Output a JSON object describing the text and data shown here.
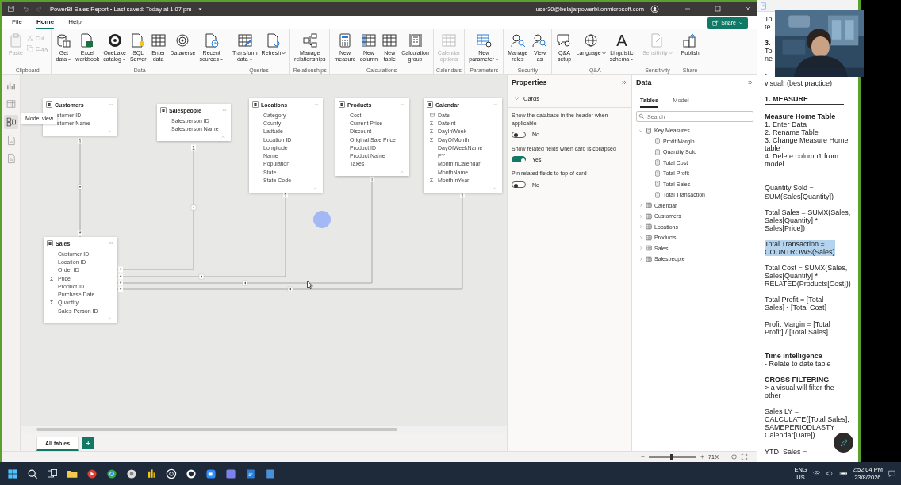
{
  "title_bar": {
    "title": "PowerBI Sales Report • Last saved: Today at 1:07 pm",
    "user": "user30@belajarpowerbi.onmicrosoft.com"
  },
  "menu_tabs": [
    {
      "label": "File",
      "selected": false
    },
    {
      "label": "Home",
      "selected": true
    },
    {
      "label": "Help",
      "selected": false
    }
  ],
  "share_button": {
    "label": "Share"
  },
  "ribbon": {
    "groups": [
      {
        "name": "Clipboard",
        "buttons": [
          {
            "label": "Paste",
            "kind": "large",
            "disabled": true,
            "dropdown": false
          },
          {
            "label": "Cut",
            "kind": "small",
            "disabled": true,
            "dropdown": false
          },
          {
            "label": "Copy",
            "kind": "small",
            "disabled": true,
            "dropdown": false
          }
        ]
      },
      {
        "name": "Data",
        "buttons": [
          {
            "label": "Get\ndata",
            "kind": "large",
            "disabled": false,
            "dropdown": true
          },
          {
            "label": "Excel\nworkbook",
            "kind": "large",
            "disabled": false,
            "dropdown": false
          },
          {
            "label": "OneLake\ncatalog",
            "kind": "large",
            "disabled": false,
            "dropdown": true
          },
          {
            "label": "SQL\nServer",
            "kind": "large",
            "disabled": false,
            "dropdown": false
          },
          {
            "label": "Enter\ndata",
            "kind": "large",
            "disabled": false,
            "dropdown": false
          },
          {
            "label": "Dataverse",
            "kind": "large",
            "disabled": false,
            "dropdown": false
          },
          {
            "label": "Recent\nsources",
            "kind": "large",
            "disabled": false,
            "dropdown": true
          }
        ]
      },
      {
        "name": "Queries",
        "buttons": [
          {
            "label": "Transform\ndata",
            "kind": "large",
            "disabled": false,
            "dropdown": true
          },
          {
            "label": "Refresh",
            "kind": "large",
            "disabled": false,
            "dropdown": true
          }
        ]
      },
      {
        "name": "Relationships",
        "buttons": [
          {
            "label": "Manage\nrelationships",
            "kind": "large",
            "disabled": false,
            "dropdown": false
          }
        ]
      },
      {
        "name": "Calculations",
        "buttons": [
          {
            "label": "New\nmeasure",
            "kind": "large",
            "disabled": false,
            "dropdown": false
          },
          {
            "label": "New\ncolumn",
            "kind": "large",
            "disabled": false,
            "dropdown": false
          },
          {
            "label": "New\ntable",
            "kind": "large",
            "disabled": false,
            "dropdown": false
          },
          {
            "label": "Calculation\ngroup",
            "kind": "large",
            "disabled": false,
            "dropdown": false
          }
        ]
      },
      {
        "name": "Calendars",
        "buttons": [
          {
            "label": "Calendar\noptions",
            "kind": "large",
            "disabled": true,
            "dropdown": false
          }
        ]
      },
      {
        "name": "Parameters",
        "buttons": [
          {
            "label": "New\nparameter",
            "kind": "large",
            "disabled": false,
            "dropdown": true
          }
        ]
      },
      {
        "name": "Security",
        "buttons": [
          {
            "label": "Manage\nroles",
            "kind": "large",
            "disabled": false,
            "dropdown": false
          },
          {
            "label": "View\nas",
            "kind": "large",
            "disabled": false,
            "dropdown": false
          }
        ]
      },
      {
        "name": "Q&A",
        "buttons": [
          {
            "label": "Q&A\nsetup",
            "kind": "large",
            "disabled": false,
            "dropdown": false
          },
          {
            "label": "Language",
            "kind": "large",
            "disabled": false,
            "dropdown": true
          },
          {
            "label": "Linguistic\nschema",
            "kind": "large",
            "disabled": false,
            "dropdown": true,
            "glyph": "A"
          }
        ]
      },
      {
        "name": "Sensitivity",
        "buttons": [
          {
            "label": "Sensitivity",
            "kind": "large",
            "disabled": true,
            "dropdown": true
          }
        ]
      },
      {
        "name": "Share",
        "buttons": [
          {
            "label": "Publish",
            "kind": "large",
            "disabled": false,
            "dropdown": false
          }
        ]
      }
    ]
  },
  "view_rail": [
    {
      "selected": false
    },
    {
      "selected": false
    },
    {
      "selected": true
    },
    {
      "selected": false
    },
    {
      "selected": false
    }
  ],
  "tooltip": "Model view",
  "diagram": {
    "tables": [
      {
        "name": "Customers",
        "fields": [
          {
            "name": "stomer ID",
            "kind": "column"
          },
          {
            "name": "stomer Name",
            "kind": "column"
          }
        ]
      },
      {
        "name": "Salespeople",
        "fields": [
          {
            "name": "Salesperson ID",
            "kind": "column"
          },
          {
            "name": "Salesperson Name",
            "kind": "column"
          }
        ]
      },
      {
        "name": "Locations",
        "fields": [
          {
            "name": "Category",
            "kind": "column"
          },
          {
            "name": "County",
            "kind": "column"
          },
          {
            "name": "Latitude",
            "kind": "column"
          },
          {
            "name": "Location ID",
            "kind": "column"
          },
          {
            "name": "Longitude",
            "kind": "column"
          },
          {
            "name": "Name",
            "kind": "column"
          },
          {
            "name": "Population",
            "kind": "column"
          },
          {
            "name": "State",
            "kind": "column"
          },
          {
            "name": "State Code",
            "kind": "column"
          }
        ]
      },
      {
        "name": "Products",
        "fields": [
          {
            "name": "Cost",
            "kind": "column"
          },
          {
            "name": "Current Price",
            "kind": "column"
          },
          {
            "name": "Discount",
            "kind": "column"
          },
          {
            "name": "Original Sale Price",
            "kind": "column"
          },
          {
            "name": "Product ID",
            "kind": "column"
          },
          {
            "name": "Product Name",
            "kind": "column"
          },
          {
            "name": "Taxes",
            "kind": "column"
          }
        ]
      },
      {
        "name": "Calendar",
        "fields": [
          {
            "name": "Date",
            "kind": "date"
          },
          {
            "name": "DateInt",
            "kind": "sum",
            "glyph": "Σ"
          },
          {
            "name": "DayInWeek",
            "kind": "sum",
            "glyph": "Σ"
          },
          {
            "name": "DayOfMonth",
            "kind": "sum",
            "glyph": "Σ"
          },
          {
            "name": "DayOfWeekName",
            "kind": "column"
          },
          {
            "name": "FY",
            "kind": "column"
          },
          {
            "name": "MonthInCalendar",
            "kind": "column"
          },
          {
            "name": "MonthName",
            "kind": "column"
          },
          {
            "name": "MonthInYear",
            "kind": "sum",
            "glyph": "Σ"
          }
        ]
      },
      {
        "name": "Sales",
        "fields": [
          {
            "name": "Customer ID",
            "kind": "column"
          },
          {
            "name": "Location ID",
            "kind": "column"
          },
          {
            "name": "Order ID",
            "kind": "column"
          },
          {
            "name": "Price",
            "kind": "sum",
            "glyph": "Σ"
          },
          {
            "name": "Product ID",
            "kind": "column"
          },
          {
            "name": "Purchase Date",
            "kind": "column"
          },
          {
            "name": "Quantity",
            "kind": "sum",
            "glyph": "Σ"
          },
          {
            "name": "Sales Person ID",
            "kind": "column"
          }
        ]
      }
    ],
    "relationships": [
      {
        "one_label": "1",
        "many_label": "*"
      },
      {
        "one_label": "1",
        "many_label": "*"
      },
      {
        "one_label": "1",
        "many_label": "*"
      },
      {
        "one_label": "1",
        "many_label": "*"
      },
      {
        "one_label": "1",
        "many_label": "*"
      }
    ]
  },
  "bottom_tabs": [
    {
      "label": "All tables",
      "selected": true
    }
  ],
  "add_tab": "+",
  "zoom": {
    "level": 0.45,
    "reading": "71%"
  },
  "properties": {
    "title": "Properties",
    "section": {
      "label": "Cards",
      "expanded": true
    },
    "settings": [
      {
        "label": "Show the database in the header when applicable",
        "on": false,
        "value": "No"
      },
      {
        "label": "Show related fields when card is collapsed",
        "on": true,
        "value": "Yes"
      },
      {
        "label": "Pin related fields to top of card",
        "on": false,
        "value": "No"
      }
    ]
  },
  "data_pane": {
    "title": "Data",
    "tabs": [
      {
        "label": "Tables",
        "selected": true
      },
      {
        "label": "Model",
        "selected": false
      }
    ],
    "search": {
      "placeholder": "Search"
    },
    "tree": [
      {
        "label": "Key Measures",
        "kind": "measures",
        "expanded": true,
        "children": [
          {
            "label": "Profit Margin"
          },
          {
            "label": "Quantity Sold"
          },
          {
            "label": "Total Cost"
          },
          {
            "label": "Total Profit"
          },
          {
            "label": "Total Sales"
          },
          {
            "label": "Total Transaction"
          }
        ]
      },
      {
        "label": "Calendar",
        "kind": "table",
        "expanded": false
      },
      {
        "label": "Customers",
        "kind": "table",
        "expanded": false
      },
      {
        "label": "Locations",
        "kind": "table",
        "expanded": false
      },
      {
        "label": "Products",
        "kind": "table",
        "expanded": false
      },
      {
        "label": "Sales",
        "kind": "table",
        "expanded": false
      },
      {
        "label": "Salespeople",
        "kind": "table",
        "expanded": false
      }
    ]
  },
  "notes": [
    {
      "kind": "text",
      "highlighted": false,
      "text": "To\nte"
    },
    {
      "kind": "text",
      "highlighted": false,
      "text": "**3.**\nTo\nne"
    },
    {
      "kind": "text",
      "highlighted": false,
      "text": "-\nvisual! (best practice)"
    },
    {
      "kind": "rule-heading",
      "highlighted": false,
      "text": "1. MEASURE"
    },
    {
      "kind": "text",
      "highlighted": false,
      "text": "**Measure Home Table**\n1. Enter Data\n2. Rename Table\n3. Change Measure Home\ntable\n4. Delete column1 from\nmodel"
    },
    {
      "kind": "spaced",
      "highlighted": false,
      "text": "Quantity Sold =\nSUM(Sales[Quantity])"
    },
    {
      "kind": "text",
      "highlighted": false,
      "text": "Total Sales = SUMX(Sales,\nSales[Quantity] *\nSales[Price])"
    },
    {
      "kind": "text",
      "highlighted": true,
      "text": "Total Transaction =\nCOUNTROWS(Sales)"
    },
    {
      "kind": "text",
      "highlighted": false,
      "text": "Total Cost = SUMX(Sales,\nSales[Quantity] *\nRELATED(Products[Cost]))"
    },
    {
      "kind": "text",
      "highlighted": false,
      "text": "Total Profit = [Total\nSales] - [Total Cost]"
    },
    {
      "kind": "text",
      "highlighted": false,
      "text": "Profit Margin = [Total\nProfit] / [Total Sales]"
    },
    {
      "kind": "spaced",
      "highlighted": false,
      "text": "**Time intelligence**\n- Relate to date table"
    },
    {
      "kind": "text",
      "highlighted": false,
      "text": "**CROSS FILTERING**\n> a visual will filter the\nother"
    },
    {
      "kind": "text",
      "highlighted": false,
      "text": "Sales LY =\nCALCULATE([Total Sales],"
    },
    {
      "kind": "continued",
      "highlighted": false,
      "text": "SAMEPERIODLASTY\nCalendar[Date])"
    },
    {
      "kind": "text",
      "highlighted": false,
      "text": "YTD  Sales ="
    }
  ],
  "taskbar": {
    "language": "ENG",
    "region": "US",
    "time": "2:52:04 PM",
    "date": "23/8/2026"
  }
}
